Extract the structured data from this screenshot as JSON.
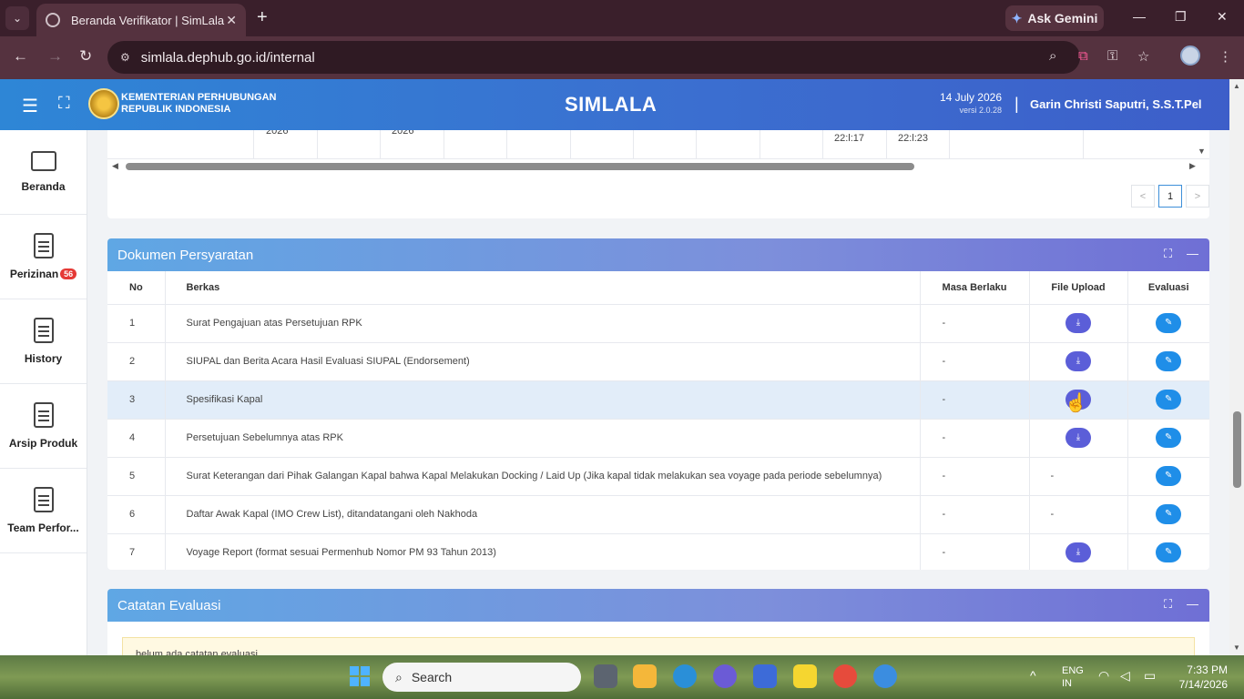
{
  "browser": {
    "tab_title": "Beranda Verifikator | SimLala",
    "tab_close": "✕",
    "new_tab": "+",
    "gemini_label": "Ask Gemini",
    "url": "simlala.dephub.go.id/internal",
    "window_controls": [
      "—",
      "❐",
      "✕"
    ]
  },
  "header": {
    "ministry_line1": "KEMENTERIAN PERHUBUNGAN",
    "ministry_line2": "REPUBLIK INDONESIA",
    "app_name": "SIMLALA",
    "date": "14 July 2026",
    "version": "versi 2.0.28",
    "separator": "|",
    "user_name": "Garin Christi Saputri, S.S.T.Pel"
  },
  "sidebar": {
    "items": [
      {
        "label": "Beranda",
        "icon": "monitor-icon"
      },
      {
        "label": "Perizinan",
        "icon": "document-icon",
        "badge": "56"
      },
      {
        "label": "History",
        "icon": "document-icon"
      },
      {
        "label": "Arsip Produk",
        "icon": "document-icon"
      },
      {
        "label": "Team Perfor...",
        "icon": "document-icon"
      }
    ]
  },
  "top_table": {
    "cells": [
      "2026",
      "2026",
      "22:l:17",
      "22:l:23"
    ],
    "pagination": {
      "prev": "<",
      "current": "1",
      "next": ">"
    }
  },
  "dokumen": {
    "title": "Dokumen Persyaratan",
    "columns": [
      "No",
      "Berkas",
      "Masa Berlaku",
      "File Upload",
      "Evaluasi"
    ],
    "rows": [
      {
        "no": "1",
        "berkas": "Surat Pengajuan atas Persetujuan RPK",
        "masa": "-",
        "file": "download"
      },
      {
        "no": "2",
        "berkas": "SIUPAL dan Berita Acara Hasil Evaluasi SIUPAL (Endorsement)",
        "masa": "-",
        "file": "download"
      },
      {
        "no": "3",
        "berkas": "Spesifikasi Kapal",
        "masa": "-",
        "file": "download"
      },
      {
        "no": "4",
        "berkas": "Persetujuan Sebelumnya atas RPK",
        "masa": "-",
        "file": "download"
      },
      {
        "no": "5",
        "berkas": "Surat Keterangan dari Pihak Galangan Kapal bahwa Kapal Melakukan Docking / Laid Up (Jika kapal tidak melakukan sea voyage pada periode sebelumnya)",
        "masa": "-",
        "file": "-"
      },
      {
        "no": "6",
        "berkas": "Daftar Awak Kapal (IMO Crew List), ditandatangani oleh Nakhoda",
        "masa": "-",
        "file": "-"
      },
      {
        "no": "7",
        "berkas": "Voyage Report (format sesuai Permenhub Nomor PM 93 Tahun 2013)",
        "masa": "-",
        "file": "download"
      }
    ]
  },
  "catatan": {
    "title": "Catatan Evaluasi",
    "empty_text": "belum ada catatan evaluasi"
  },
  "taskbar": {
    "search_placeholder": "Search",
    "lang_line1": "ENG",
    "lang_line2": "IN",
    "time": "7:33 PM",
    "date": "7/14/2026"
  },
  "colors": {
    "header_start": "#2e86d6",
    "header_end": "#3d5ec9",
    "download_button": "#5b5ed8",
    "evaluate_button": "#1f8ee8",
    "badge": "#e53935"
  }
}
